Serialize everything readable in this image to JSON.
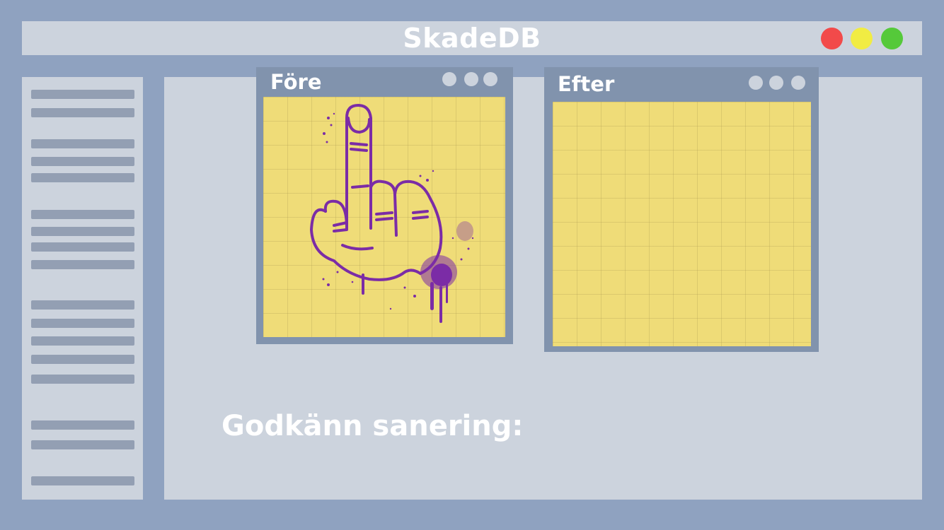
{
  "window": {
    "title": "SkadeDB",
    "controls": [
      "close-control",
      "minimize-control",
      "maximize-control"
    ]
  },
  "panels": {
    "before": {
      "title": "Före"
    },
    "after": {
      "title": "Efter"
    }
  },
  "main": {
    "prompt": "Godkänn sanering:"
  },
  "colors": {
    "background": "#8fa2c0",
    "surface": "#ccd3dd",
    "panel_frame": "#8193ad",
    "paper": "#efdc78",
    "graffiti": "#7b2ca6",
    "control_red": "#f24a4a",
    "control_yellow": "#f1ec43",
    "control_green": "#55c93a"
  }
}
